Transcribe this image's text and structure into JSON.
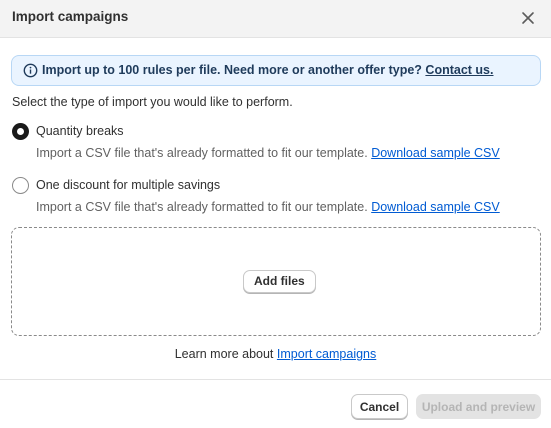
{
  "dialog": {
    "title": "Import campaigns",
    "close_icon": "close-icon"
  },
  "banner": {
    "icon": "info-icon",
    "message": "Import up to 100 rules per file. Need more or another offer type?",
    "link": "Contact us."
  },
  "prompt": "Select the type of import you would like to perform.",
  "options": [
    {
      "label": "Quantity breaks",
      "selected": true,
      "description": "Import a CSV file that's already formatted to fit our template.",
      "link": "Download sample CSV"
    },
    {
      "label": "One discount for multiple savings",
      "selected": false,
      "description": "Import a CSV file that's already formatted to fit our template.",
      "link": "Download sample CSV"
    }
  ],
  "dropzone": {
    "button": "Add files"
  },
  "learn_more": {
    "text": "Learn more about",
    "link": "Import campaigns"
  },
  "footer": {
    "cancel": "Cancel",
    "upload": "Upload and preview",
    "upload_disabled": true
  },
  "colors": {
    "banner_bg": "#eaf4ff",
    "link": "#005bd3",
    "header_bg": "#f3f3f3"
  }
}
